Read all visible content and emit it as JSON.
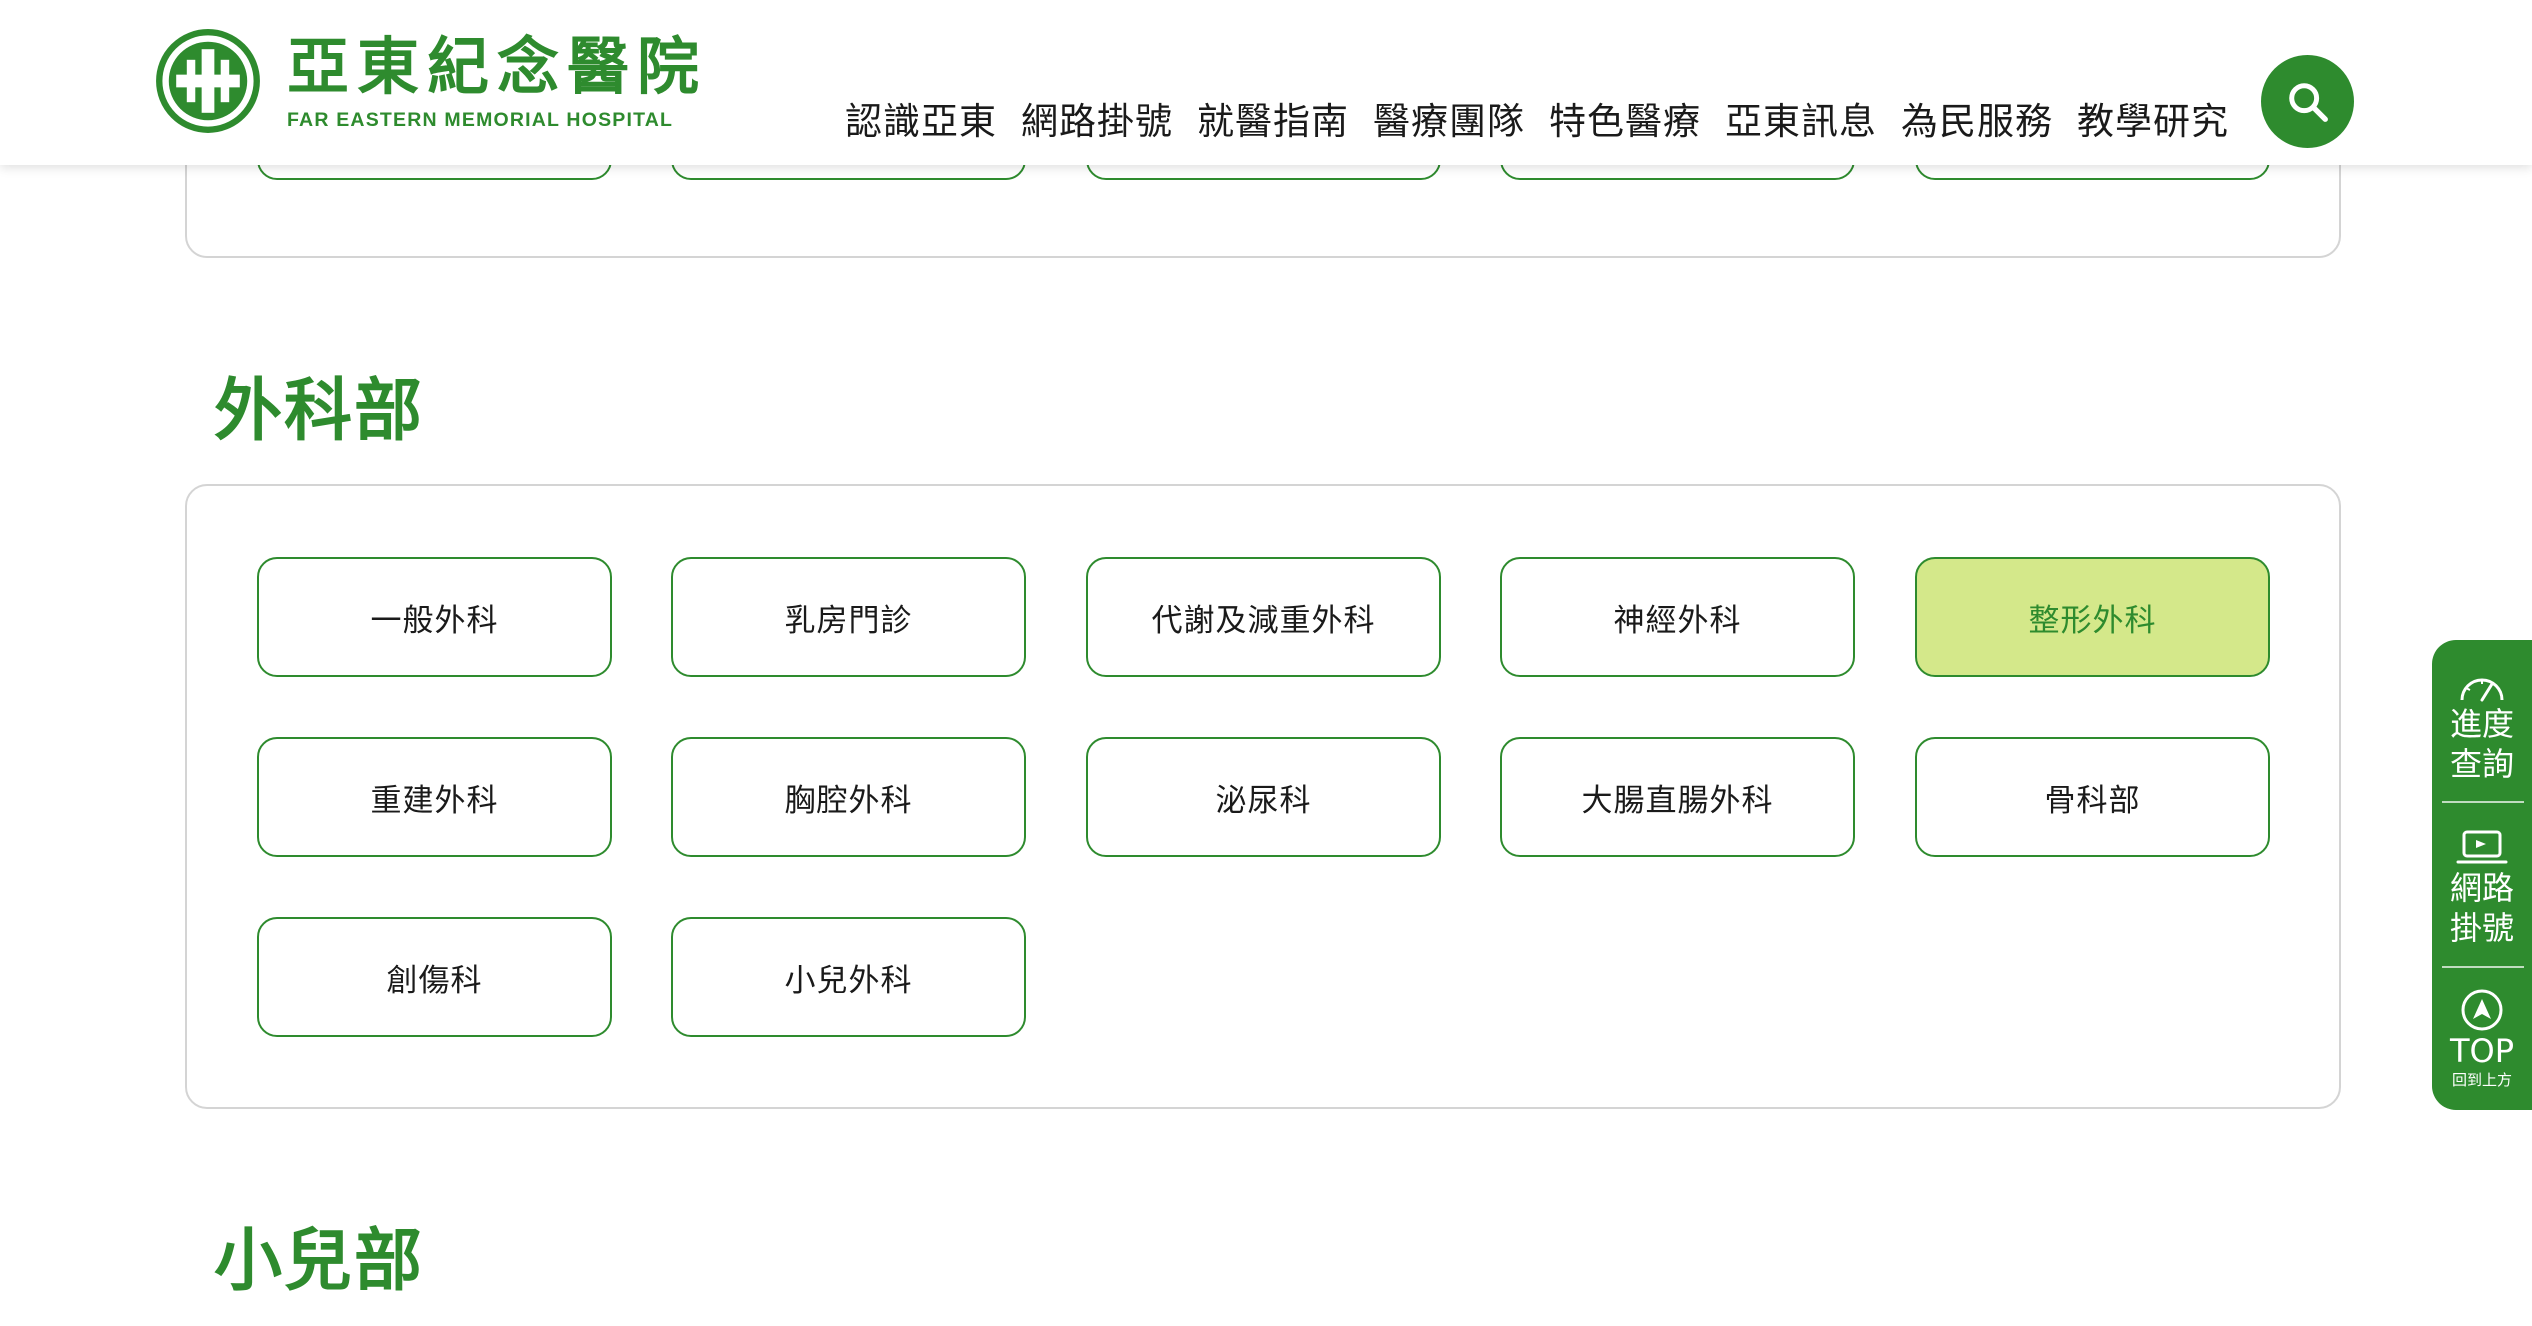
{
  "brand": {
    "name_cn": "亞東紀念醫院",
    "name_en": "FAR EASTERN MEMORIAL HOSPITAL",
    "primary_color": "#2e8b2e",
    "active_fill": "#d4e88a"
  },
  "nav": {
    "items": [
      "認識亞東",
      "網路掛號",
      "就醫指南",
      "醫療團隊",
      "特色醫療",
      "亞東訊息",
      "為民服務",
      "教學研究"
    ]
  },
  "search": {
    "icon": "search-icon"
  },
  "surgery_section": {
    "title": "外科部",
    "departments": [
      {
        "label": "一般外科",
        "active": false
      },
      {
        "label": "乳房門診",
        "active": false
      },
      {
        "label": "代謝及減重外科",
        "active": false
      },
      {
        "label": "神經外科",
        "active": false
      },
      {
        "label": "整形外科",
        "active": true
      },
      {
        "label": "重建外科",
        "active": false
      },
      {
        "label": "胸腔外科",
        "active": false
      },
      {
        "label": "泌尿科",
        "active": false
      },
      {
        "label": "大腸直腸外科",
        "active": false
      },
      {
        "label": "骨科部",
        "active": false
      },
      {
        "label": "創傷科",
        "active": false
      },
      {
        "label": "小兒外科",
        "active": false
      }
    ]
  },
  "pediatrics_section": {
    "title": "小兒部"
  },
  "side_bar": {
    "progress": {
      "line1": "進度",
      "line2": "查詢",
      "icon": "speedometer-icon"
    },
    "register": {
      "line1": "網路",
      "line2": "掛號",
      "icon": "laptop-icon"
    },
    "top": {
      "label": "TOP",
      "sub": "回到上方",
      "icon": "arrow-up-circle-icon"
    }
  }
}
